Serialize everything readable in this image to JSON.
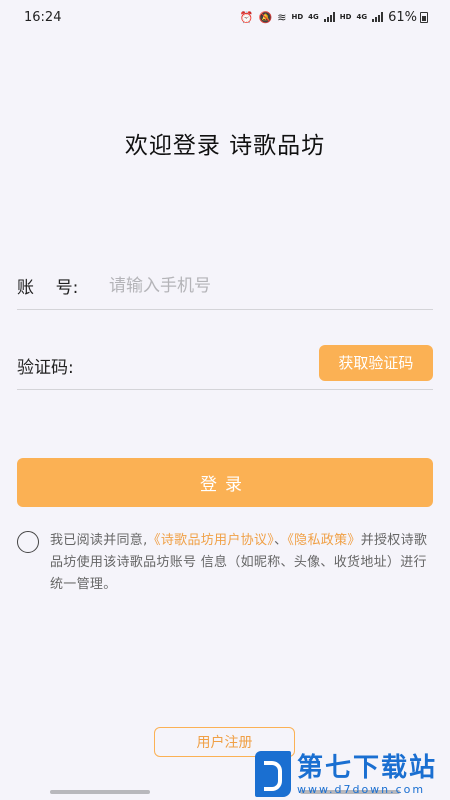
{
  "status_bar": {
    "time": "16:24",
    "hd1": "HD",
    "net1": "4G",
    "hd2": "HD",
    "net2": "4G",
    "battery": "61%"
  },
  "title": "欢迎登录 诗歌品坊",
  "account": {
    "label": "账    号:",
    "placeholder": "请输入手机号"
  },
  "code": {
    "label": "验证码:",
    "button": "获取验证码"
  },
  "login_button": "登录",
  "agreement": {
    "prefix": "我已阅读并同意,",
    "user_agreement": "《诗歌品坊用户协议》",
    "separator": "、",
    "privacy_policy": "《隐私政策》",
    "suffix": "并授权诗歌品坊使用该诗歌品坊账号 信息（如昵称、头像、收货地址）进行统一管理。"
  },
  "register_button": "用户注册",
  "watermark": {
    "name": "第七下载站",
    "url": "www.d7down.com"
  }
}
